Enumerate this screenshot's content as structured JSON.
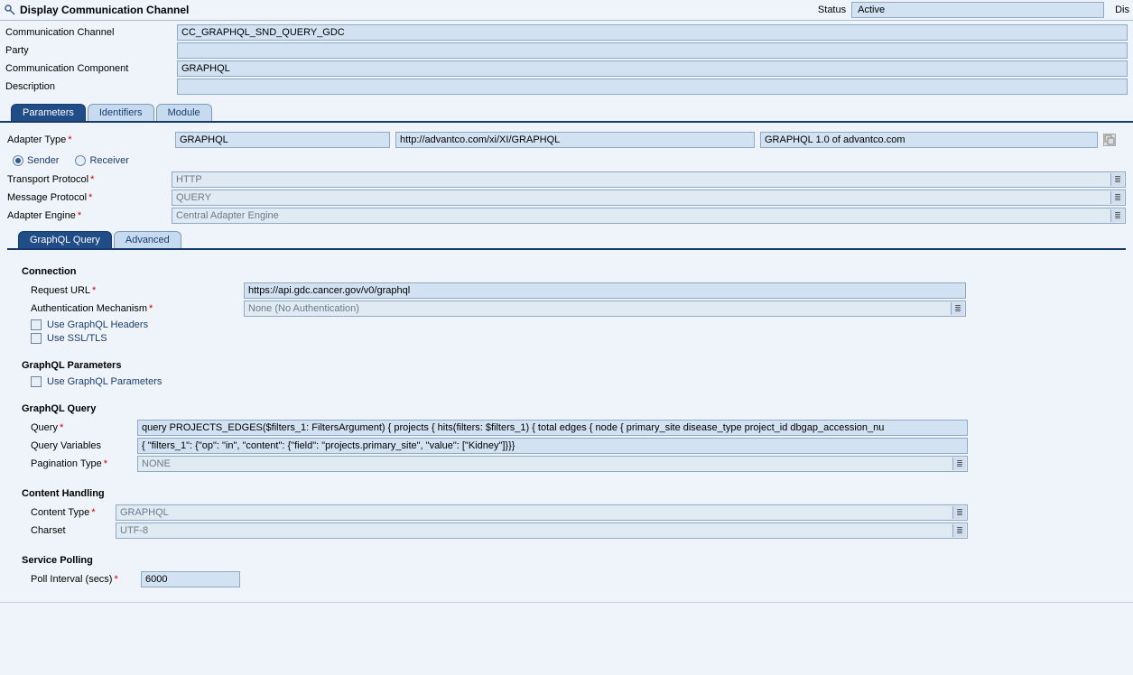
{
  "header": {
    "title": "Display Communication Channel",
    "status_label": "Status",
    "status_value": "Active",
    "right_truncated": "Dis"
  },
  "top_form": {
    "channel_label": "Communication Channel",
    "channel_value": "CC_GRAPHQL_SND_QUERY_GDC",
    "party_label": "Party",
    "party_value": "",
    "component_label": "Communication Component",
    "component_value": "GRAPHQL",
    "description_label": "Description",
    "description_value": ""
  },
  "main_tabs": {
    "parameters": "Parameters",
    "identifiers": "Identifiers",
    "module": "Module"
  },
  "adapter": {
    "type_label": "Adapter Type",
    "type_value": "GRAPHQL",
    "namespace": "http://advantco.com/xi/XI/GRAPHQL",
    "version": "GRAPHQL 1.0 of advantco.com",
    "sender": "Sender",
    "receiver": "Receiver",
    "transport_label": "Transport Protocol",
    "transport_value": "HTTP",
    "message_label": "Message Protocol",
    "message_value": "QUERY",
    "engine_label": "Adapter Engine",
    "engine_value": "Central Adapter Engine"
  },
  "sub_tabs": {
    "query": "GraphQL Query",
    "advanced": "Advanced"
  },
  "connection": {
    "section": "Connection",
    "request_url_label": "Request URL",
    "request_url_value": "https://api.gdc.cancer.gov/v0/graphql",
    "auth_label": "Authentication Mechanism",
    "auth_value": "None (No Authentication)",
    "use_headers": "Use GraphQL Headers",
    "use_ssl": "Use SSL/TLS"
  },
  "params": {
    "section": "GraphQL Parameters",
    "use_params": "Use GraphQL Parameters"
  },
  "gquery": {
    "section": "GraphQL Query",
    "query_label": "Query",
    "query_value": "query PROJECTS_EDGES($filters_1: FiltersArgument) { projects { hits(filters: $filters_1) { total edges { node { primary_site disease_type project_id dbgap_accession_nu",
    "vars_label": "Query Variables",
    "vars_value": "{ \"filters_1\": {\"op\": \"in\", \"content\": {\"field\": \"projects.primary_site\", \"value\": [\"Kidney\"]}}}",
    "pagination_label": "Pagination Type",
    "pagination_value": "NONE"
  },
  "content": {
    "section": "Content Handling",
    "type_label": "Content Type",
    "type_value": "GRAPHQL",
    "charset_label": "Charset",
    "charset_value": "UTF-8"
  },
  "polling": {
    "section": "Service Polling",
    "interval_label": "Poll Interval (secs)",
    "interval_value": "6000"
  }
}
